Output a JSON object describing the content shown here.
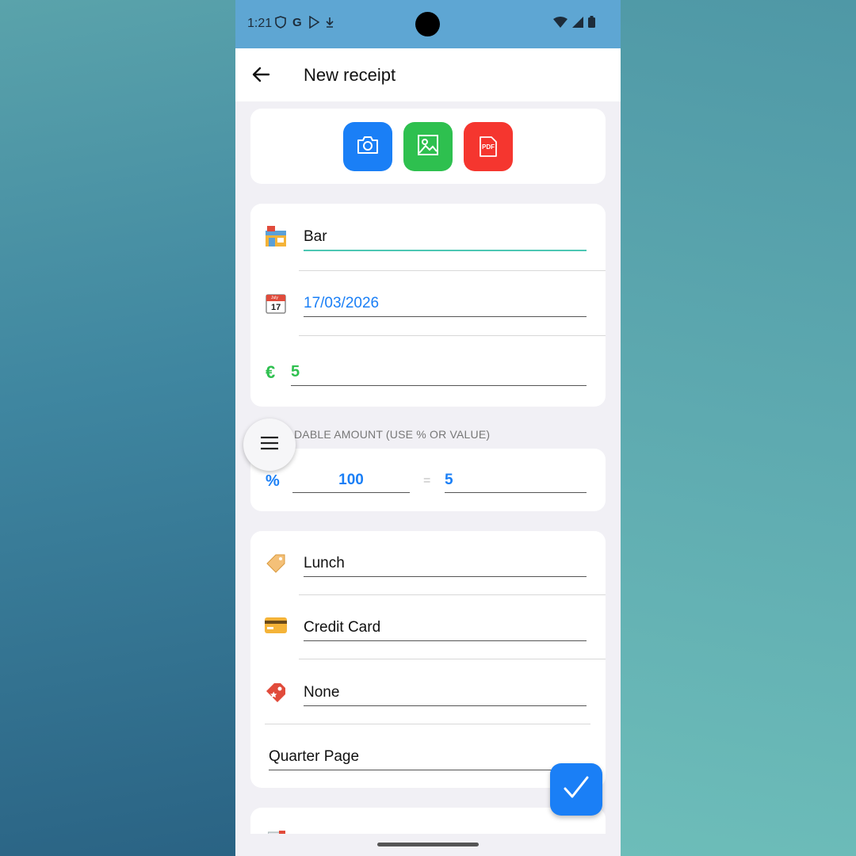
{
  "status_bar": {
    "time": "1:21",
    "icons": [
      "shield-icon",
      "google-icon",
      "play-store-icon",
      "download-icon"
    ],
    "right_icons": [
      "wifi-icon",
      "signal-icon",
      "battery-icon"
    ]
  },
  "app_bar": {
    "title": "New receipt",
    "back_icon": "arrow-left-icon"
  },
  "attachments": {
    "buttons": [
      {
        "name": "camera",
        "color": "#1a7ff6",
        "icon": "camera-icon"
      },
      {
        "name": "gallery",
        "color": "#2ec04f",
        "icon": "image-icon"
      },
      {
        "name": "pdf",
        "color": "#f5362f",
        "icon": "pdf-icon",
        "label": "PDF"
      }
    ]
  },
  "receipt": {
    "store": {
      "icon": "store-icon",
      "value": "Bar"
    },
    "date": {
      "icon": "calendar-icon",
      "calendar_month": "July",
      "calendar_day": "17",
      "value": "17/03/2026"
    },
    "amount": {
      "currency_symbol": "€",
      "value": "5"
    }
  },
  "deductible": {
    "label": "DABLE AMOUNT (USE % OR VALUE)",
    "percent_symbol": "%",
    "percent_value": "100",
    "equals": "=",
    "computed_value": "5"
  },
  "details": {
    "category": {
      "icon": "tag-icon",
      "value": "Lunch"
    },
    "payment": {
      "icon": "credit-card-icon",
      "value": "Credit Card"
    },
    "label": {
      "icon": "bookmark-tag-icon",
      "value": "None"
    },
    "page_size": {
      "value": "Quarter Page"
    }
  },
  "colors": {
    "accent": "#1a7ff6",
    "green": "#2ec04f",
    "teal_underline": "#4cc7b3"
  }
}
